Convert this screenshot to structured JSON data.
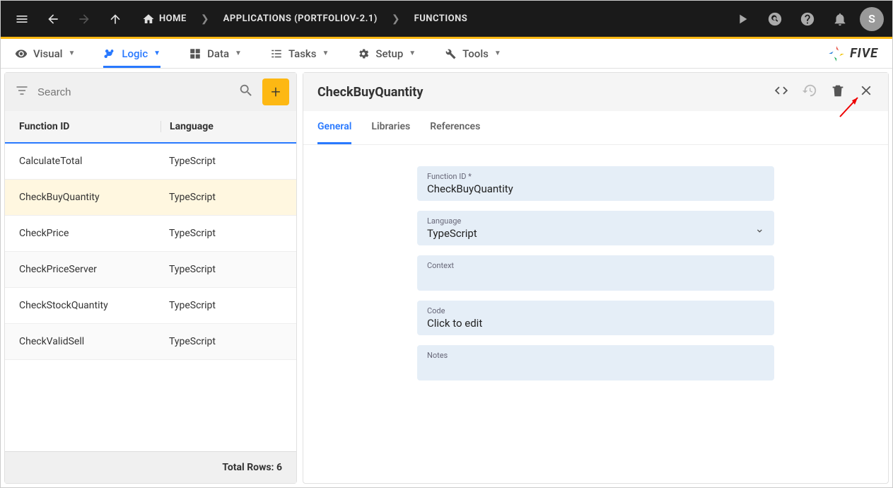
{
  "topbar": {
    "breadcrumbs": [
      "HOME",
      "APPLICATIONS (PORTFOLIOV-2.1)",
      "FUNCTIONS"
    ],
    "avatar_letter": "S"
  },
  "menubar": {
    "items": [
      {
        "label": "Visual",
        "icon": "eye"
      },
      {
        "label": "Logic",
        "icon": "branch",
        "active": true
      },
      {
        "label": "Data",
        "icon": "grid"
      },
      {
        "label": "Tasks",
        "icon": "list"
      },
      {
        "label": "Setup",
        "icon": "gear"
      },
      {
        "label": "Tools",
        "icon": "wrench"
      }
    ],
    "brand": "FIVE"
  },
  "list": {
    "search_placeholder": "Search",
    "columns": [
      "Function ID",
      "Language"
    ],
    "rows": [
      {
        "fn": "CalculateTotal",
        "lang": "TypeScript"
      },
      {
        "fn": "CheckBuyQuantity",
        "lang": "TypeScript",
        "selected": true
      },
      {
        "fn": "CheckPrice",
        "lang": "TypeScript"
      },
      {
        "fn": "CheckPriceServer",
        "lang": "TypeScript"
      },
      {
        "fn": "CheckStockQuantity",
        "lang": "TypeScript"
      },
      {
        "fn": "CheckValidSell",
        "lang": "TypeScript"
      }
    ],
    "footer": "Total Rows: 6"
  },
  "detail": {
    "title": "CheckBuyQuantity",
    "tabs": [
      "General",
      "Libraries",
      "References"
    ],
    "fields": {
      "function_id_label": "Function ID *",
      "function_id_value": "CheckBuyQuantity",
      "language_label": "Language",
      "language_value": "TypeScript",
      "context_label": "Context",
      "context_value": "",
      "code_label": "Code",
      "code_value": "Click to edit",
      "notes_label": "Notes",
      "notes_value": ""
    }
  }
}
